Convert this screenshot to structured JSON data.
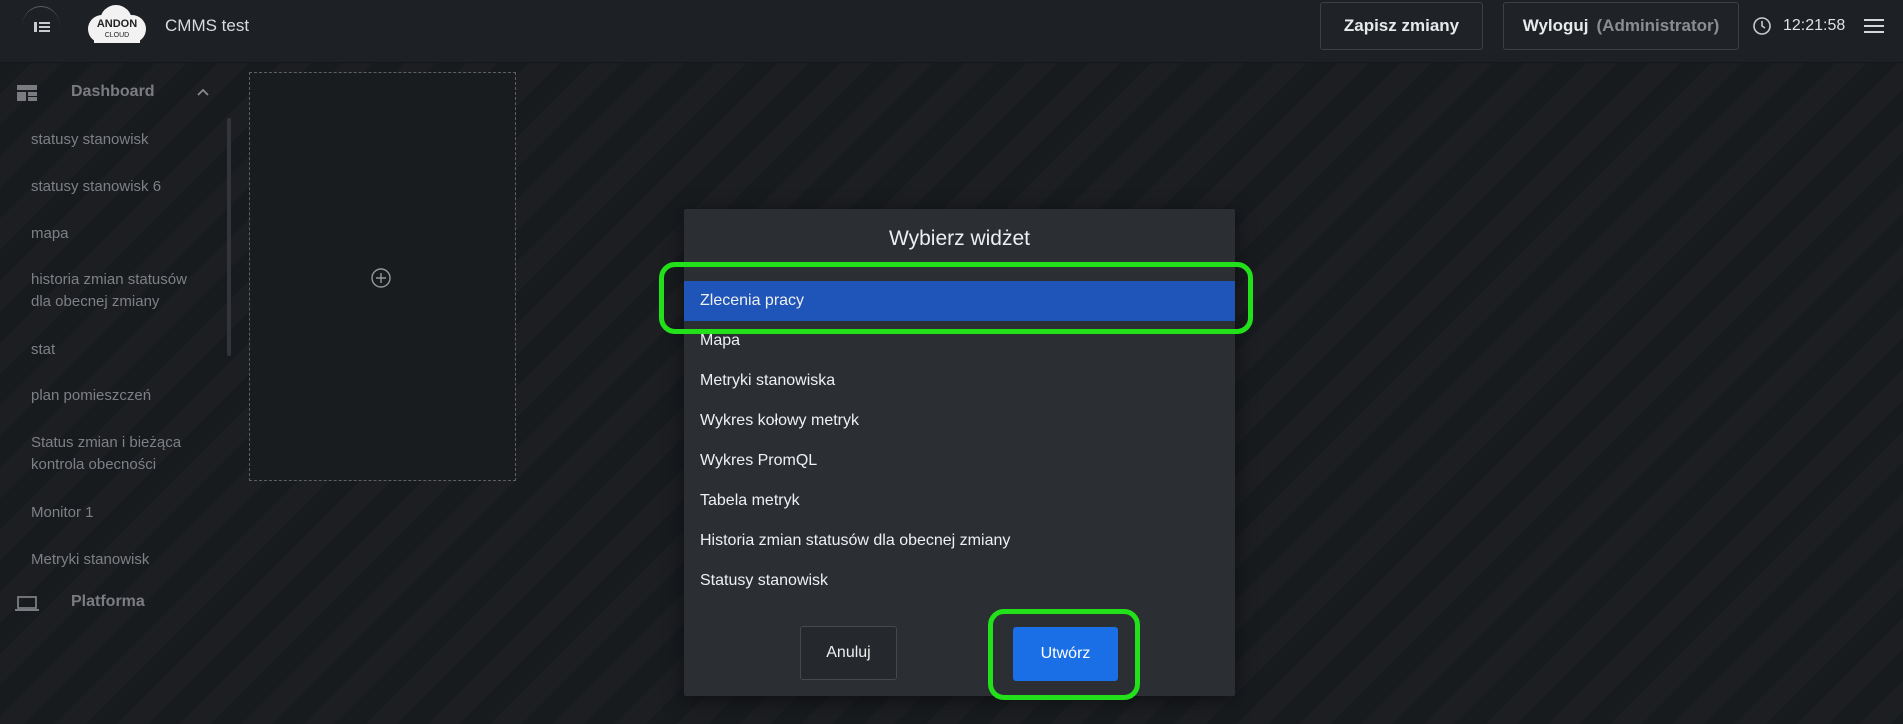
{
  "header": {
    "logo_text": "ANDON CLOUD",
    "app_title": "CMMS test",
    "save_label": "Zapisz zmiany",
    "logout_label": "Wyloguj",
    "logout_role": "(Administrator)",
    "clock": "12:21:58"
  },
  "sidebar": {
    "section_title": "Dashboard",
    "items": [
      {
        "label": "statusy stanowisk"
      },
      {
        "label": "statusy stanowisk 6"
      },
      {
        "label": "mapa"
      },
      {
        "label": "historia zmian statusów dla obecnej zmiany"
      },
      {
        "label": "stat"
      },
      {
        "label": "plan pomieszczeń"
      },
      {
        "label": "Status zmian i bieżąca kontrola obecności"
      },
      {
        "label": "Monitor 1"
      },
      {
        "label": "Metryki stanowisk"
      }
    ],
    "platform_label": "Platforma"
  },
  "modal": {
    "title": "Wybierz widżet",
    "options": [
      {
        "label": "Zlecenia pracy",
        "selected": true
      },
      {
        "label": "Mapa"
      },
      {
        "label": "Metryki stanowiska"
      },
      {
        "label": "Wykres kołowy metryk"
      },
      {
        "label": "Wykres PromQL"
      },
      {
        "label": "Tabela metryk"
      },
      {
        "label": "Historia zmian statusów dla obecnej zmiany"
      },
      {
        "label": "Statusy stanowisk"
      }
    ],
    "cancel_label": "Anuluj",
    "create_label": "Utwórz"
  },
  "colors": {
    "highlight": "#22e01a",
    "selected_item": "#1f55b8",
    "primary_button": "#1a6ee6"
  }
}
